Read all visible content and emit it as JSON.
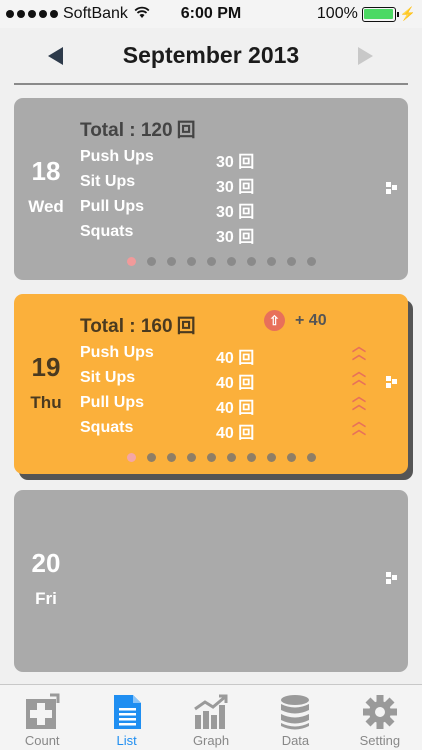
{
  "status_bar": {
    "carrier": "SoftBank",
    "time": "6:00 PM",
    "battery": "100%"
  },
  "header": {
    "title": "September 2013"
  },
  "total_label": "Total : ",
  "unit": "回",
  "days": [
    {
      "date": "18",
      "weekday": "Wed",
      "total": "120",
      "exercises": [
        {
          "name": "Push Ups",
          "count": "30"
        },
        {
          "name": "Sit Ups",
          "count": "30"
        },
        {
          "name": "Pull Ups",
          "count": "30"
        },
        {
          "name": "Squats",
          "count": "30"
        }
      ]
    },
    {
      "date": "19",
      "weekday": "Thu",
      "total": "160",
      "delta": "+ 40",
      "exercises": [
        {
          "name": "Push Ups",
          "count": "40"
        },
        {
          "name": "Sit Ups",
          "count": "40"
        },
        {
          "name": "Pull Ups",
          "count": "40"
        },
        {
          "name": "Squats",
          "count": "40"
        }
      ]
    },
    {
      "date": "20",
      "weekday": "Fri"
    }
  ],
  "tabs": [
    {
      "label": "Count",
      "icon": "count-plus-icon"
    },
    {
      "label": "List",
      "icon": "list-document-icon"
    },
    {
      "label": "Graph",
      "icon": "graph-chart-icon"
    },
    {
      "label": "Data",
      "icon": "data-database-icon"
    },
    {
      "label": "Setting",
      "icon": "setting-gear-icon"
    }
  ],
  "colors": {
    "card_gray": "#aaaaaa",
    "card_highlight": "#fbb03b",
    "accent_blue": "#1f8ef1",
    "trend_up": "#e8705a"
  }
}
